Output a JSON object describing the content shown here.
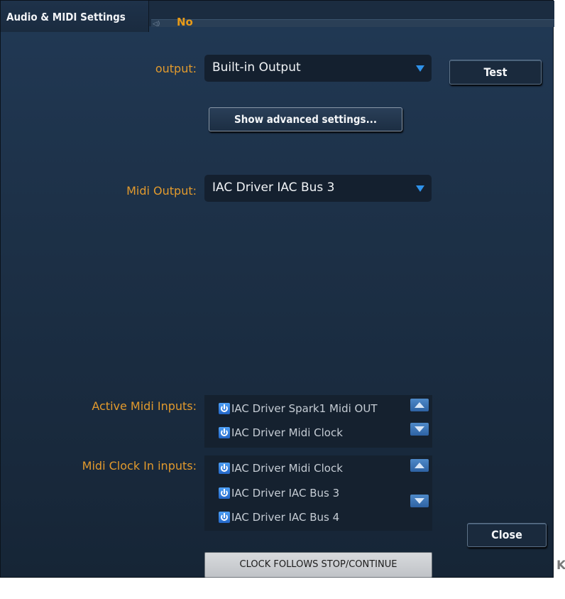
{
  "window": {
    "title": "Audio & MIDI Settings",
    "peek_tab_text": "No",
    "peek_tab_icon": "speaker-icon"
  },
  "audio": {
    "output_label": "output:",
    "output_value": "Built-in Output",
    "test_button": "Test",
    "advanced_button": "Show advanced settings..."
  },
  "midi": {
    "output_label": "Midi Output:",
    "output_value": "IAC Driver IAC Bus 3"
  },
  "active_inputs": {
    "label": "Active Midi Inputs:",
    "items": [
      {
        "label": "IAC Driver Spark1 Midi OUT"
      },
      {
        "label": "IAC Driver Midi Clock"
      }
    ]
  },
  "clock_inputs": {
    "label": "Midi Clock In inputs:",
    "items": [
      {
        "label": "IAC Driver Midi Clock"
      },
      {
        "label": "IAC Driver IAC Bus 3"
      },
      {
        "label": "IAC Driver IAC Bus 4"
      }
    ]
  },
  "buttons": {
    "close": "Close",
    "clock_follows": "CLOCK FOLLOWS STOP/CONTINUE"
  },
  "stray_char": "K",
  "colors": {
    "accent_label": "#e29a2d",
    "panel_bg": "#1d3148",
    "toggle_blue": "#2f92ea"
  }
}
